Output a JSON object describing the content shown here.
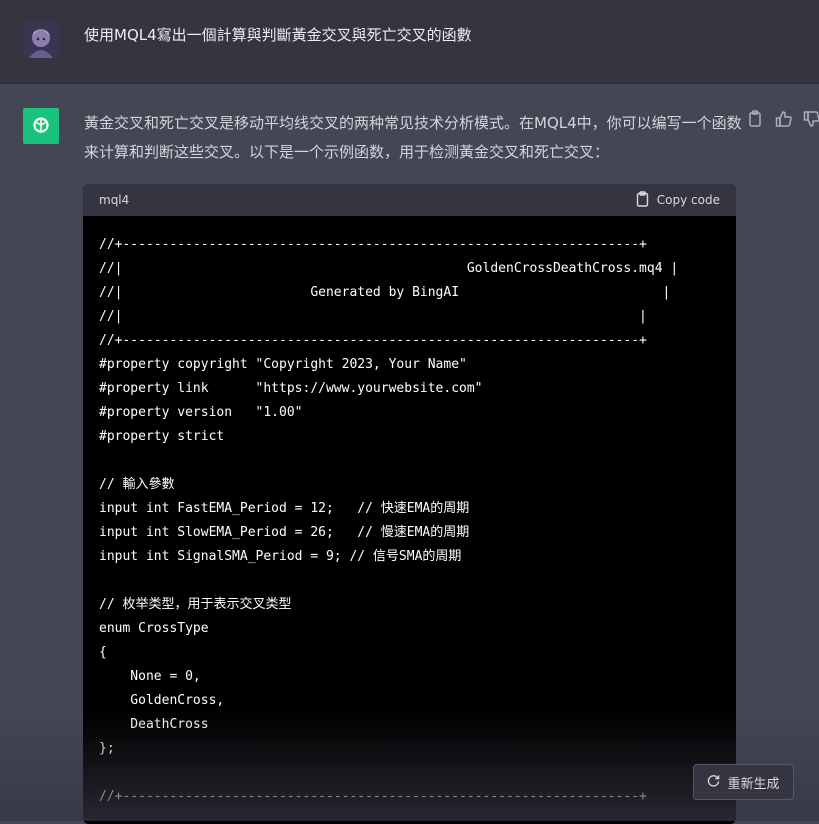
{
  "user": {
    "message": "使用MQL4寫出一個計算與判斷黃金交叉與死亡交叉的函數"
  },
  "assistant": {
    "reply": "黃金交叉和死亡交叉是移动平均线交叉的两种常见技术分析模式。在MQL4中，你可以编写一个函数来计算和判断这些交叉。以下是一个示例函数，用于检测黃金交叉和死亡交叉：",
    "actions": [
      "copy-icon",
      "thumbs-up-icon",
      "thumbs-down-icon"
    ]
  },
  "code": {
    "language": "mql4",
    "copy_label": "Copy code",
    "lines": [
      "//+------------------------------------------------------------------+",
      "//|                                            GoldenCrossDeathCross.mq4 |",
      "//|                        Generated by BingAI                          |",
      "//|                                                                  |",
      "//+------------------------------------------------------------------+",
      "#property copyright \"Copyright 2023, Your Name\"",
      "#property link      \"https://www.yourwebsite.com\"",
      "#property version   \"1.00\"",
      "#property strict",
      "",
      "// 輸入參數",
      "input int FastEMA_Period = 12;   // 快速EMA的周期",
      "input int SlowEMA_Period = 26;   // 慢速EMA的周期",
      "input int SignalSMA_Period = 9; // 信号SMA的周期",
      "",
      "// 枚举类型，用于表示交叉类型",
      "enum CrossType",
      "{",
      "    None = 0,",
      "    GoldenCross,",
      "    DeathCross",
      "};",
      "",
      "//+------------------------------------------------------------------+"
    ]
  },
  "regenerate": {
    "label": "重新生成"
  },
  "colors": {
    "accent": "#19c37d",
    "background": "#444654",
    "user_background": "#343541"
  }
}
